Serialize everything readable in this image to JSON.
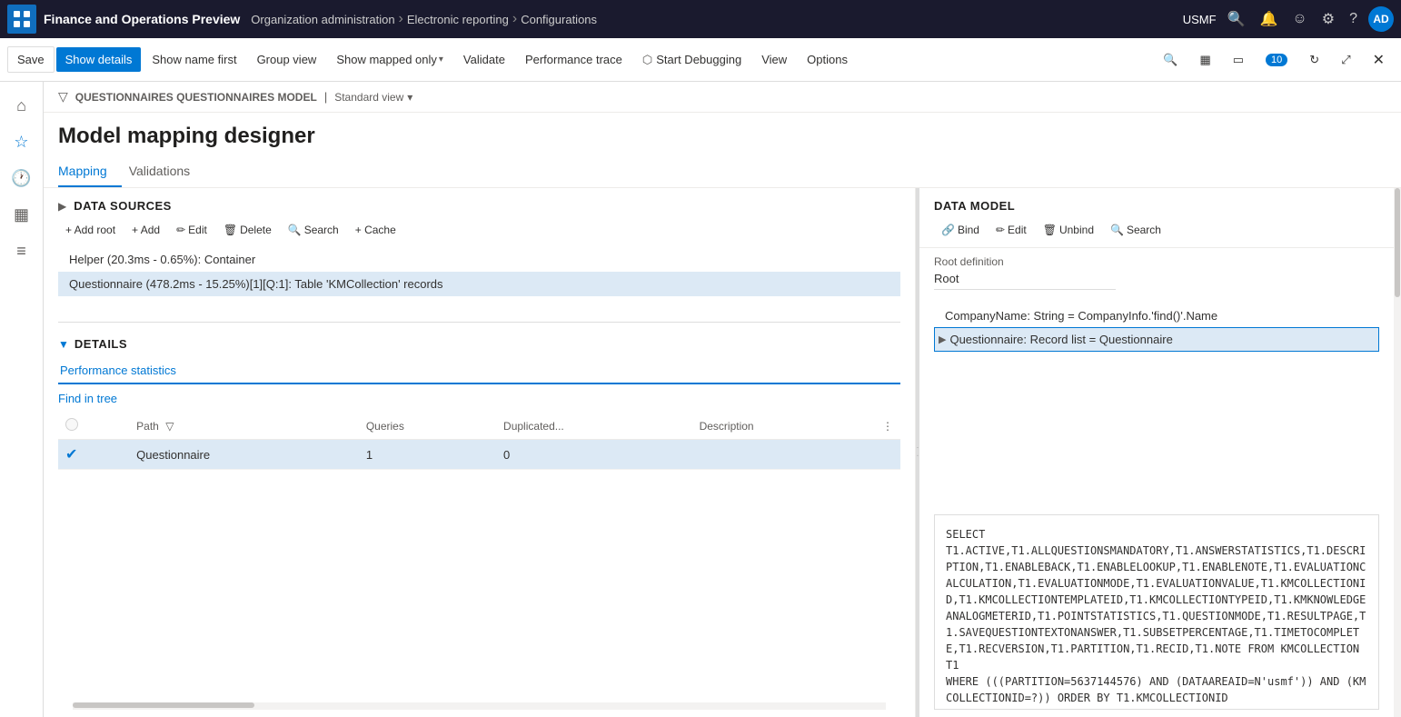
{
  "topnav": {
    "logo_label": "Apps",
    "app_name": "Finance and Operations Preview",
    "breadcrumbs": [
      {
        "label": "Organization administration"
      },
      {
        "label": "Electronic reporting"
      },
      {
        "label": "Configurations"
      }
    ],
    "user_context": "USMF",
    "avatar": "AD"
  },
  "toolbar": {
    "save_label": "Save",
    "show_details_label": "Show details",
    "show_name_first_label": "Show name first",
    "group_view_label": "Group view",
    "show_mapped_only_label": "Show mapped only",
    "validate_label": "Validate",
    "performance_trace_label": "Performance trace",
    "start_debugging_label": "Start Debugging",
    "view_label": "View",
    "options_label": "Options"
  },
  "breadcrumb": {
    "path": "QUESTIONNAIRES QUESTIONNAIRES MODEL",
    "view": "Standard view"
  },
  "page": {
    "title": "Model mapping designer"
  },
  "tabs": {
    "mapping_label": "Mapping",
    "validations_label": "Validations"
  },
  "data_sources": {
    "section_title": "DATA SOURCES",
    "actions": {
      "add_root": "+ Add root",
      "add": "+ Add",
      "edit": "Edit",
      "delete": "Delete",
      "search": "Search",
      "cache": "+ Cache"
    },
    "items": [
      {
        "label": "Helper (20.3ms - 0.65%): Container",
        "selected": false
      },
      {
        "label": "Questionnaire (478.2ms - 15.25%)[1][Q:1]: Table 'KMCollection' records",
        "selected": true
      }
    ]
  },
  "details": {
    "section_title": "DETAILS",
    "tab_label": "Performance statistics",
    "find_in_tree_label": "Find in tree",
    "table": {
      "columns": [
        "Path",
        "Queries",
        "Duplicated...",
        "Description"
      ],
      "rows": [
        {
          "path": "Questionnaire",
          "queries": "1",
          "duplicated": "0",
          "description": ""
        }
      ]
    }
  },
  "data_model": {
    "section_title": "DATA MODEL",
    "actions": {
      "bind": "Bind",
      "edit": "Edit",
      "unbind": "Unbind",
      "search": "Search"
    },
    "root_definition_label": "Root definition",
    "root_value": "Root",
    "items": [
      {
        "label": "CompanyName: String = CompanyInfo.'find()'.Name",
        "expand": false,
        "selected": false
      },
      {
        "label": "Questionnaire: Record list = Questionnaire",
        "expand": true,
        "selected": true
      }
    ]
  },
  "sql_panel": {
    "content": "SELECT\nT1.ACTIVE,T1.ALLQUESTIONSMANDATORY,T1.ANSWERSTATISTICS,T1.DESCRIPTION,T1.ENABLEBACK,T1.ENABLELOOKUP,T1.ENABLENOTE,T1.EVALUATIONCALCULATION,T1.EVALUATIONMODE,T1.EVALUATIONVALUE,T1.KMCOLLECTIONID,T1.KMCOLLECTIONTEMPLATEID,T1.KMCOLLECTIONTYPEID,T1.KMKNOWLEDGEANALOGMETERID,T1.POINTSTATISTICS,T1.QUESTIONMODE,T1.RESULTPAGE,T1.SAVEQUESTIONTEXTONANSWER,T1.SUBSETPERCENTAGE,T1.TIMETOCOMPLETE,T1.RECVERSION,T1.PARTITION,T1.RECID,T1.NOTE FROM KMCOLLECTION T1\nWHERE (((PARTITION=5637144576) AND (DATAAREAID=N'usmf')) AND (KMCOLLECTIONID=?)) ORDER BY T1.KMCOLLECTIONID"
  }
}
